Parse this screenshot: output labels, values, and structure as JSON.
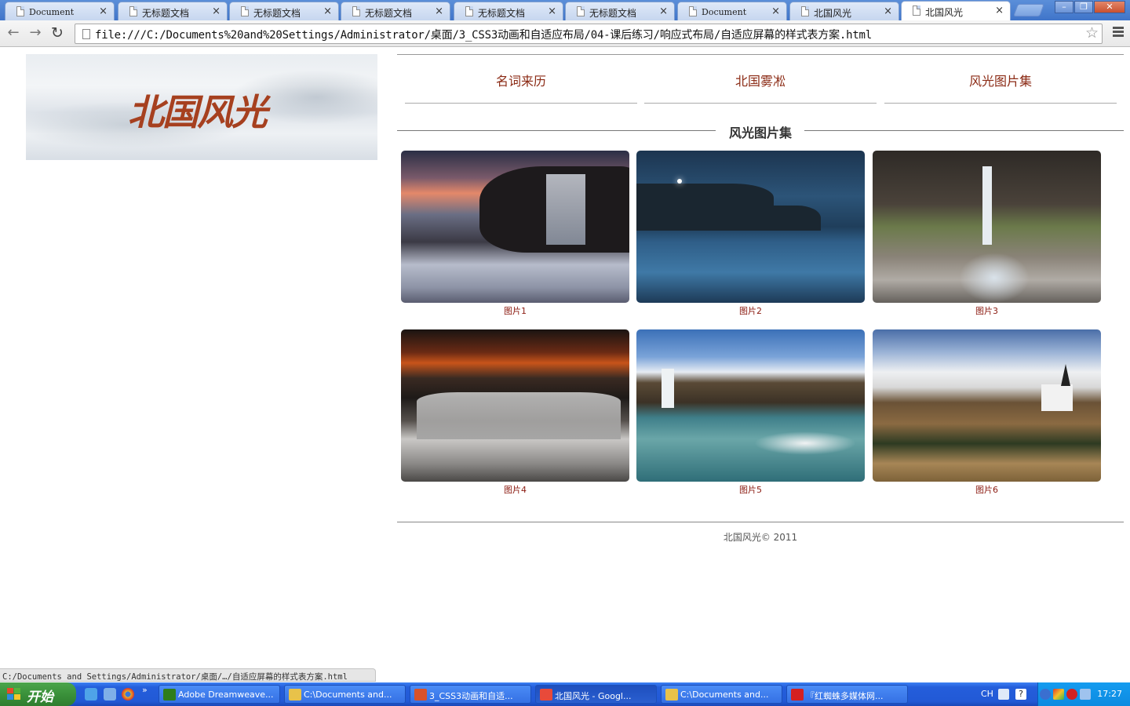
{
  "browser": {
    "tabs": [
      {
        "title": "Document",
        "active": false,
        "mono": true
      },
      {
        "title": "无标题文档",
        "active": false,
        "mono": false
      },
      {
        "title": "无标题文档",
        "active": false,
        "mono": false
      },
      {
        "title": "无标题文档",
        "active": false,
        "mono": false
      },
      {
        "title": "无标题文档",
        "active": false,
        "mono": false
      },
      {
        "title": "无标题文档",
        "active": false,
        "mono": false
      },
      {
        "title": "Document",
        "active": false,
        "mono": true
      },
      {
        "title": "北国风光",
        "active": false,
        "mono": false
      },
      {
        "title": "北国风光",
        "active": true,
        "mono": false
      }
    ],
    "tab_close_glyph": "×",
    "window_controls": {
      "minimize": "–",
      "restore": "❐",
      "close": "✕"
    },
    "address": "file:///C:/Documents%20and%20Settings/Administrator/桌面/3_CSS3动画和自适应布局/04-课后练习/响应式布局/自适应屏幕的样式表方案.html",
    "status_url": "C:/Documents and Settings/Administrator/桌面/…/自适应屏幕的样式表方案.html"
  },
  "page": {
    "banner_text": "北国风光",
    "nav": [
      "名词来历",
      "北国雾凇",
      "风光图片集"
    ],
    "section_title": "风光图片集",
    "photos": [
      {
        "caption": "图片1"
      },
      {
        "caption": "图片2"
      },
      {
        "caption": "图片3"
      },
      {
        "caption": "图片4"
      },
      {
        "caption": "图片5"
      },
      {
        "caption": "图片6"
      }
    ],
    "footer": "北国风光© 2011",
    "colors": {
      "nav_link": "#8b2a14",
      "caption": "#8b1a10",
      "banner_text": "#a6401f"
    }
  },
  "taskbar": {
    "start_label": "开始",
    "tasks": [
      {
        "label": "Adobe Dreamweave...",
        "icon_color": "#2f7d1a",
        "active": false
      },
      {
        "label": "C:\\Documents and...",
        "icon_color": "#e8c24a",
        "active": false
      },
      {
        "label": "3_CSS3动画和自适...",
        "icon_color": "#d9522a",
        "active": false
      },
      {
        "label": "北国风光 - Googl...",
        "icon_color": "#e84a3a",
        "active": true
      },
      {
        "label": "C:\\Documents and...",
        "icon_color": "#e8c24a",
        "active": false
      },
      {
        "label": "『红蜘蛛多媒体网...",
        "icon_color": "#d42020",
        "active": false
      }
    ],
    "lang": "CH",
    "clock": "17:27",
    "more_glyph": "»"
  }
}
